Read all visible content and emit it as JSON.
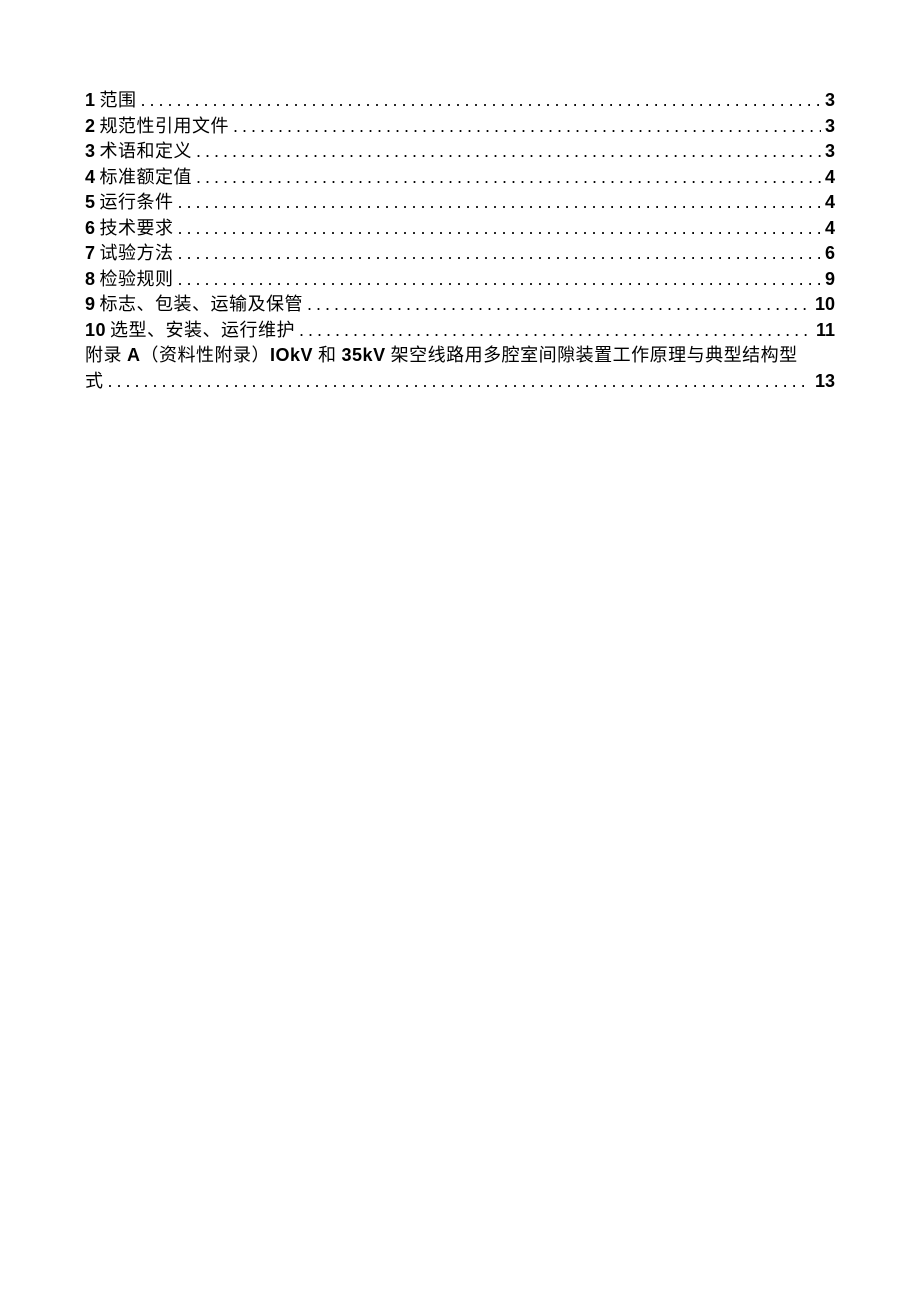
{
  "toc": {
    "entries": [
      {
        "num": "1",
        "label": "范围",
        "page": "3"
      },
      {
        "num": "2",
        "label": "规范性引用文件",
        "page": "3"
      },
      {
        "num": "3",
        "label": "术语和定义",
        "page": "3"
      },
      {
        "num": "4",
        "label": "标准额定值",
        "page": "4"
      },
      {
        "num": "5",
        "label": "运行条件",
        "page": "4"
      },
      {
        "num": "6",
        "label": "技术要求",
        "page": "4"
      },
      {
        "num": "7",
        "label": "试验方法",
        "page": "6"
      },
      {
        "num": "8",
        "label": "检验规则",
        "page": "9"
      },
      {
        "num": "9",
        "label": "标志、包装、运输及保管",
        "page": "10"
      },
      {
        "num": "10",
        "label": "选型、安装、运行维护",
        "page": "11"
      }
    ],
    "appendix": {
      "line1_prefix": "附录",
      "line1_letter": "A",
      "line1_mid": "（资料性附录）",
      "line1_bold1": "IOkV",
      "line1_and": "和",
      "line1_bold2": "35kV",
      "line1_tail": "架空线路用多腔室间隙装置工作原理与典型结构型",
      "line2_prefix": "式",
      "page": "13"
    }
  },
  "dots": "........................................................................................................................"
}
